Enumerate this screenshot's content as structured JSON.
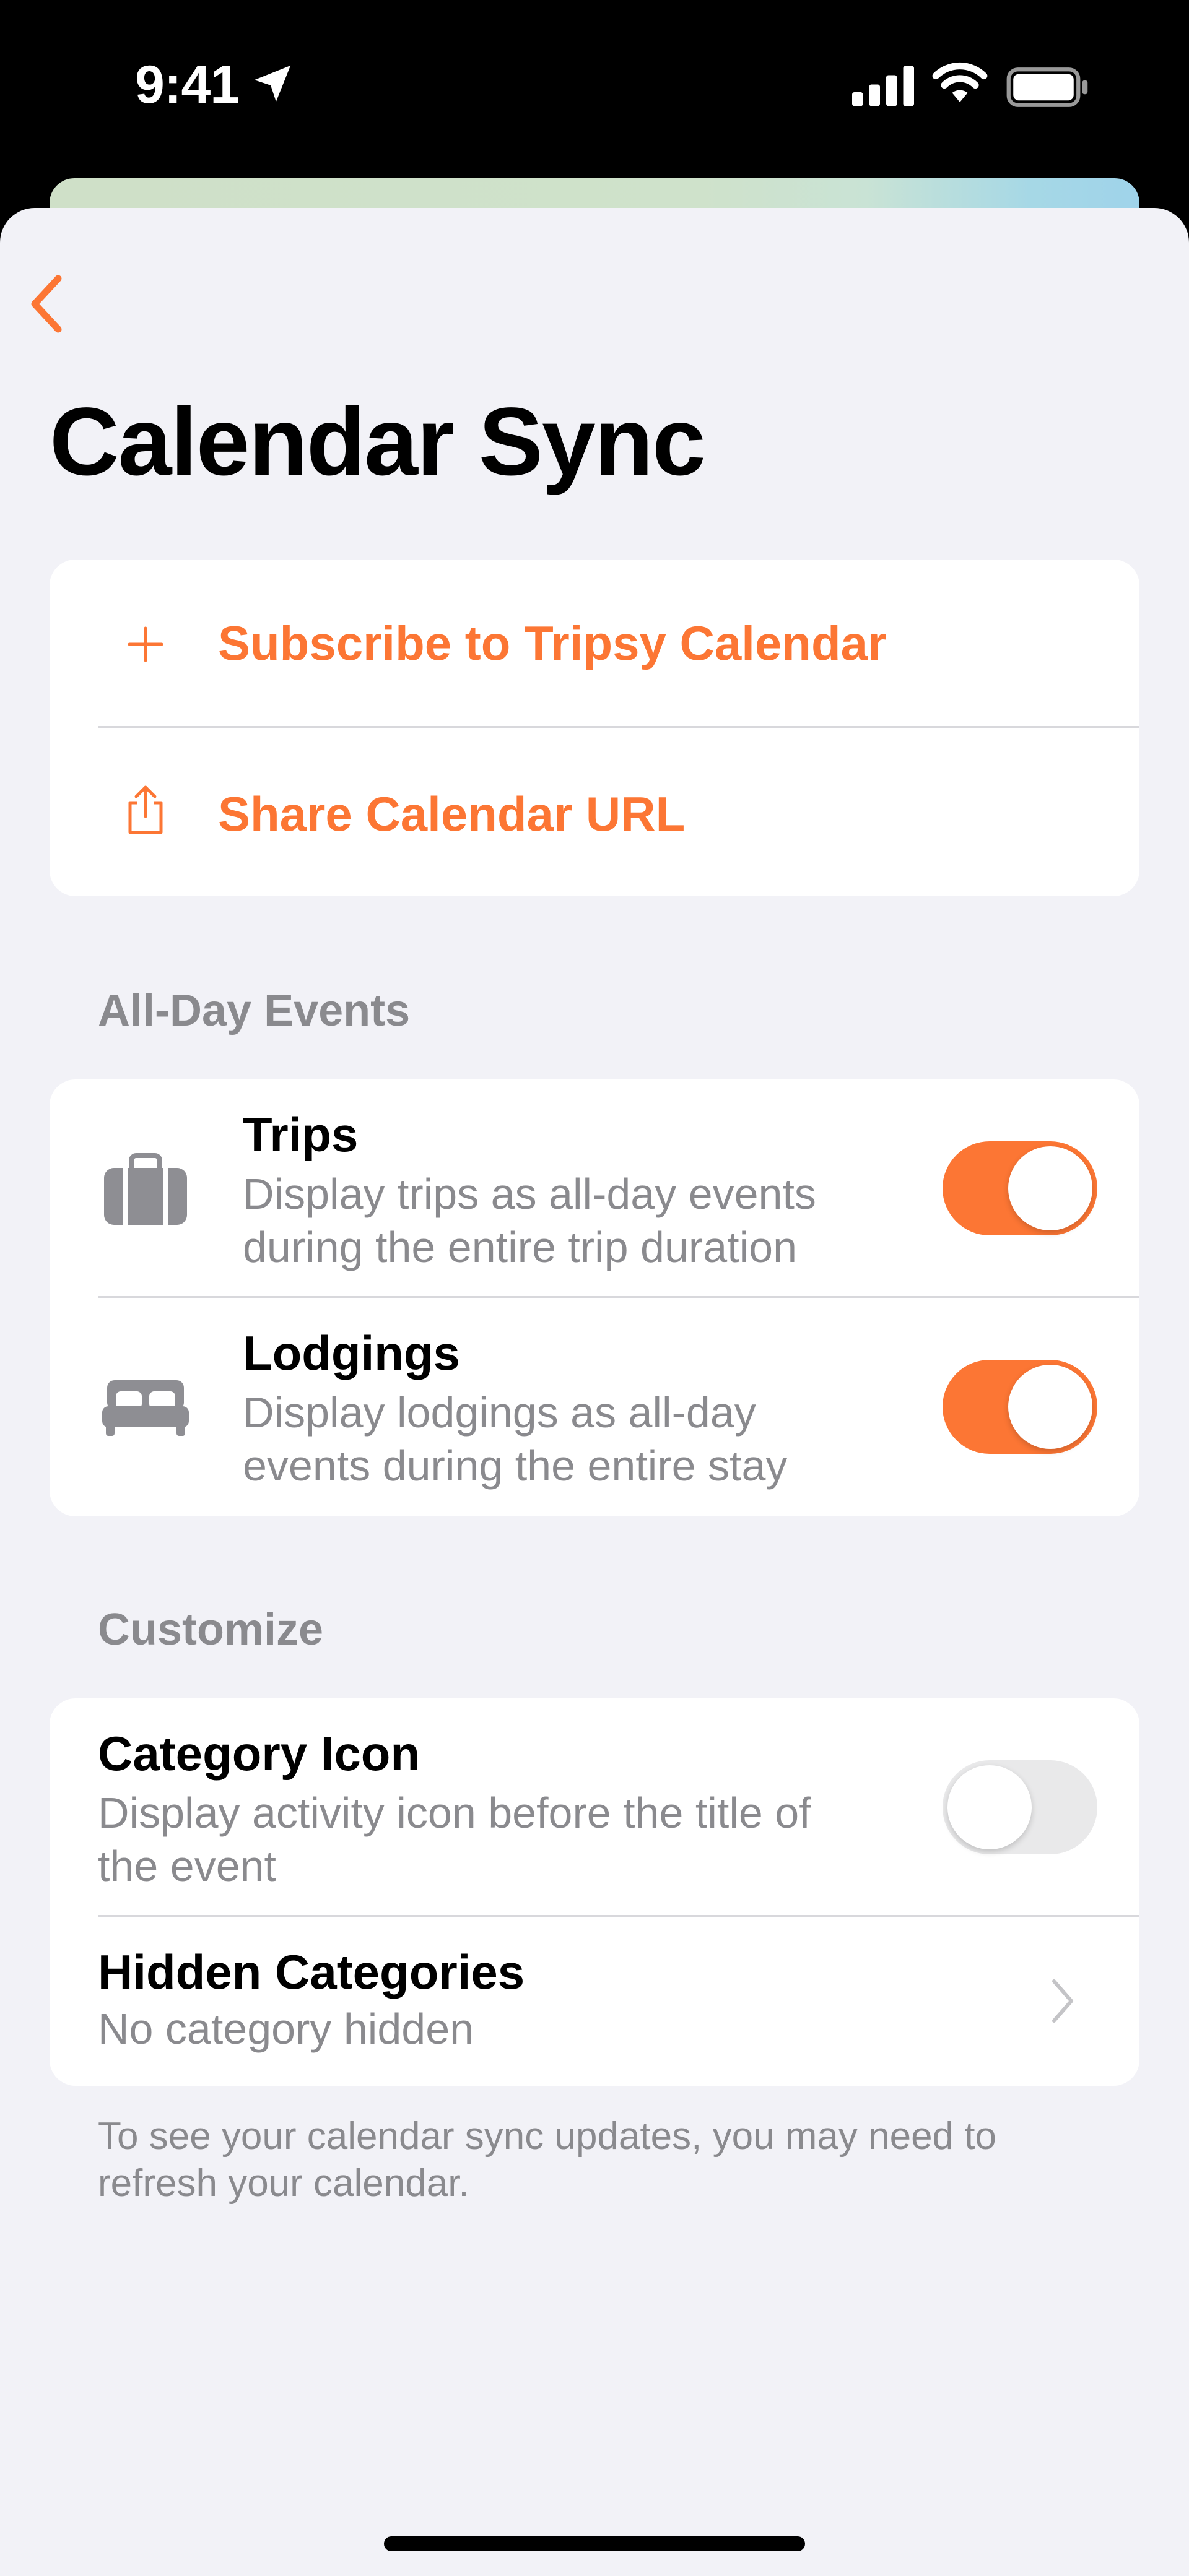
{
  "status_bar": {
    "time": "9:41"
  },
  "nav": {
    "back_icon": "chevron-left-icon"
  },
  "page": {
    "title": "Calendar Sync"
  },
  "actions": [
    {
      "icon": "plus-icon",
      "label": "Subscribe to Tripsy Calendar"
    },
    {
      "icon": "share-icon",
      "label": "Share Calendar URL"
    }
  ],
  "all_day": {
    "header": "All-Day Events",
    "rows": [
      {
        "icon": "suitcase-icon",
        "title": "Trips",
        "subtitle_line1": "Display trips as all-day events",
        "subtitle_line2": "during the entire trip duration",
        "enabled": true
      },
      {
        "icon": "bed-icon",
        "title": "Lodgings",
        "subtitle_line1": "Display lodgings as all-day",
        "subtitle_line2": "events during the entire stay",
        "enabled": true
      }
    ]
  },
  "customize": {
    "header": "Customize",
    "category_icon": {
      "title": "Category Icon",
      "subtitle_line1": "Display activity icon before the title of",
      "subtitle_line2": "the event",
      "enabled": false
    },
    "hidden_categories": {
      "title": "Hidden Categories",
      "subtitle": "No category hidden"
    }
  },
  "footer": {
    "note": "To see your calendar sync updates, you may need to refresh your calendar."
  },
  "colors": {
    "accent": "#fc7634",
    "background": "#f2f2f7",
    "secondary_text": "#8a8a8e"
  }
}
